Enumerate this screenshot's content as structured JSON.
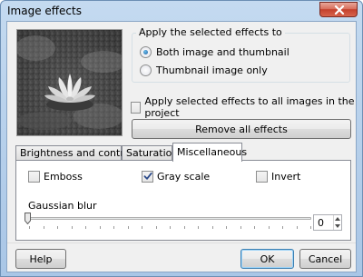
{
  "window": {
    "title": "Image effects"
  },
  "apply_group": {
    "legend": "Apply the selected effects to",
    "options": [
      {
        "label": "Both image and thumbnail",
        "selected": true
      },
      {
        "label": "Thumbnail image only",
        "selected": false
      }
    ]
  },
  "apply_all": {
    "label": "Apply selected effects to all images in the project",
    "checked": false
  },
  "remove_all_label": "Remove all effects",
  "tabs": [
    {
      "label": "Brightness and contrast",
      "active": false
    },
    {
      "label": "Saturation",
      "active": false
    },
    {
      "label": "Miscellaneous",
      "active": true
    }
  ],
  "misc": {
    "emboss": {
      "label": "Emboss",
      "checked": false
    },
    "grayscale": {
      "label": "Gray scale",
      "checked": true
    },
    "invert": {
      "label": "Invert",
      "checked": false
    },
    "blur_label": "Gaussian blur",
    "blur_value": "0"
  },
  "footer": {
    "help_label": "Help",
    "ok_label": "OK",
    "cancel_label": "Cancel"
  },
  "colors": {
    "accent": "#3c7fb1",
    "close_button": "#c4402c",
    "title_bar": "#b8d2ee"
  },
  "icons": {
    "close": "close-icon",
    "check": "check-icon",
    "spin_up": "spin-up-icon",
    "spin_down": "spin-down-icon"
  }
}
